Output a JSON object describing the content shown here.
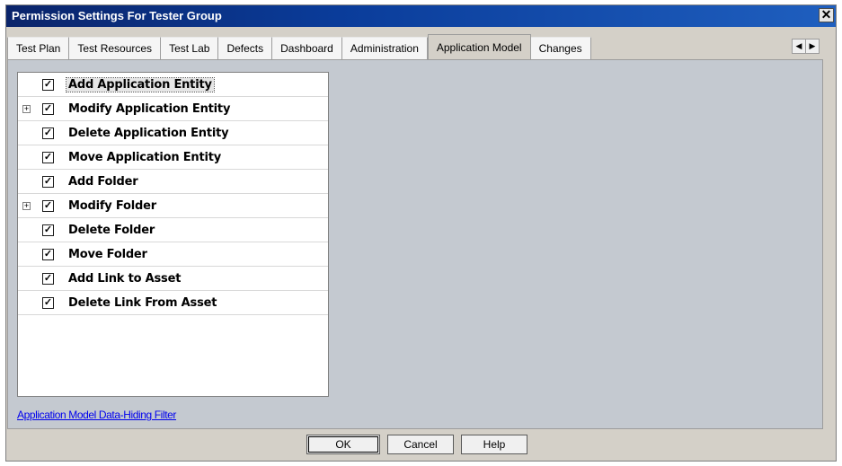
{
  "window": {
    "title": "Permission Settings For Tester Group",
    "close_glyph": "✕"
  },
  "tabs": [
    {
      "label": "Test Plan",
      "active": false
    },
    {
      "label": "Test Resources",
      "active": false
    },
    {
      "label": "Test Lab",
      "active": false
    },
    {
      "label": "Defects",
      "active": false
    },
    {
      "label": "Dashboard",
      "active": false
    },
    {
      "label": "Administration",
      "active": false
    },
    {
      "label": "Application Model",
      "active": true
    },
    {
      "label": "Changes",
      "active": false
    }
  ],
  "tab_scroll": {
    "left_icon": "triangle-left-icon",
    "right_icon": "triangle-right-icon",
    "left_glyph": "◀",
    "right_glyph": "▶"
  },
  "permissions": [
    {
      "label": "Add Application Entity",
      "checked": true,
      "expandable": false,
      "selected": true
    },
    {
      "label": "Modify Application Entity",
      "checked": true,
      "expandable": true,
      "selected": false
    },
    {
      "label": "Delete Application Entity",
      "checked": true,
      "expandable": false,
      "selected": false
    },
    {
      "label": "Move Application Entity",
      "checked": true,
      "expandable": false,
      "selected": false
    },
    {
      "label": "Add Folder",
      "checked": true,
      "expandable": false,
      "selected": false
    },
    {
      "label": "Modify Folder",
      "checked": true,
      "expandable": true,
      "selected": false
    },
    {
      "label": "Delete Folder",
      "checked": true,
      "expandable": false,
      "selected": false
    },
    {
      "label": "Move Folder",
      "checked": true,
      "expandable": false,
      "selected": false
    },
    {
      "label": "Add Link to Asset",
      "checked": true,
      "expandable": false,
      "selected": false
    },
    {
      "label": "Delete Link From Asset",
      "checked": true,
      "expandable": false,
      "selected": false
    }
  ],
  "check_glyph": "✓",
  "expand_glyph": "+",
  "filter_link": "Application Model Data-Hiding Filter",
  "buttons": {
    "ok": "OK",
    "cancel": "Cancel",
    "help": "Help"
  },
  "colors": {
    "title_bar": "#0a246a",
    "panel_bg": "#c4c9d0",
    "link": "#0000ee"
  }
}
